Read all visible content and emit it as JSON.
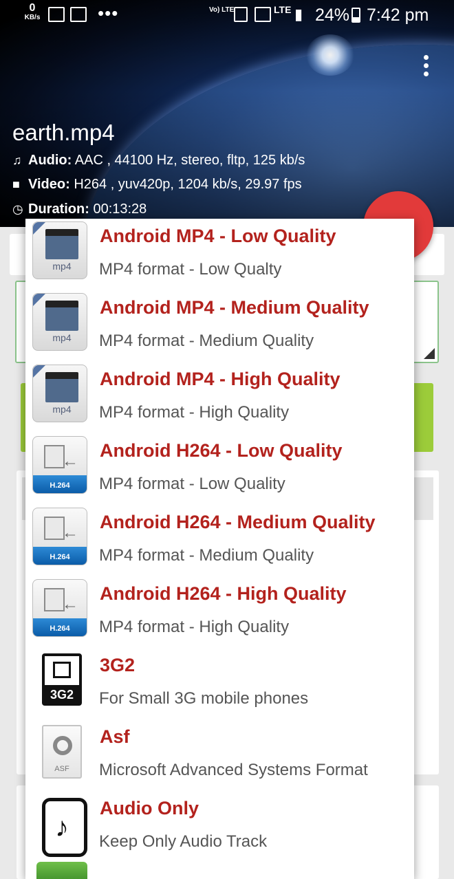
{
  "status_bar": {
    "net_speed_value": "0",
    "net_speed_unit": "KB/s",
    "more_notifications": "•••",
    "volte_label": "Vo) LTE",
    "lte_label": "LTE",
    "battery_percent": "24%",
    "time": "7:42 pm"
  },
  "file": {
    "name": "earth.mp4",
    "audio_label": "Audio:",
    "audio_value": " AAC , 44100 Hz, stereo, fltp, 125 kb/s",
    "video_label": "Video:",
    "video_value": " H264 , yuv420p, 1204 kb/s, 29.97 fps",
    "duration_label": "Duration:",
    "duration_value": " 00:13:28"
  },
  "format_menu": {
    "items": [
      {
        "title": "Android MP4 - Low Quality",
        "desc": "MP4 format - Low Qualty",
        "icon": "mp4-icon",
        "icon_label": "mp4"
      },
      {
        "title": "Android MP4 - Medium Quality",
        "desc": "MP4 format - Medium Quality",
        "icon": "mp4-icon",
        "icon_label": "mp4"
      },
      {
        "title": "Android MP4 - High Quality",
        "desc": "MP4 format - High Quality",
        "icon": "mp4-icon",
        "icon_label": "mp4"
      },
      {
        "title": "Android H264 - Low Quality",
        "desc": "MP4 format - Low Quality",
        "icon": "h264-icon",
        "icon_label": "H.264"
      },
      {
        "title": "Android H264 - Medium Quality",
        "desc": "MP4 format - Medium Quality",
        "icon": "h264-icon",
        "icon_label": "H.264"
      },
      {
        "title": "Android H264 - High Quality",
        "desc": "MP4 format - High Quality",
        "icon": "h264-icon",
        "icon_label": "H.264"
      },
      {
        "title": "3G2",
        "desc": "For Small 3G mobile phones",
        "icon": "3g2-icon",
        "icon_label": "3G2"
      },
      {
        "title": "Asf",
        "desc": "Microsoft Advanced Systems Format",
        "icon": "asf-icon",
        "icon_label": "ASF"
      },
      {
        "title": "Audio Only",
        "desc": "Keep Only Audio Track",
        "icon": "audio-file-icon",
        "icon_label": ""
      }
    ]
  },
  "colors": {
    "item_title": "#b3221d",
    "fab": "#e23a3a",
    "h264_band": "#0b5ca8"
  }
}
